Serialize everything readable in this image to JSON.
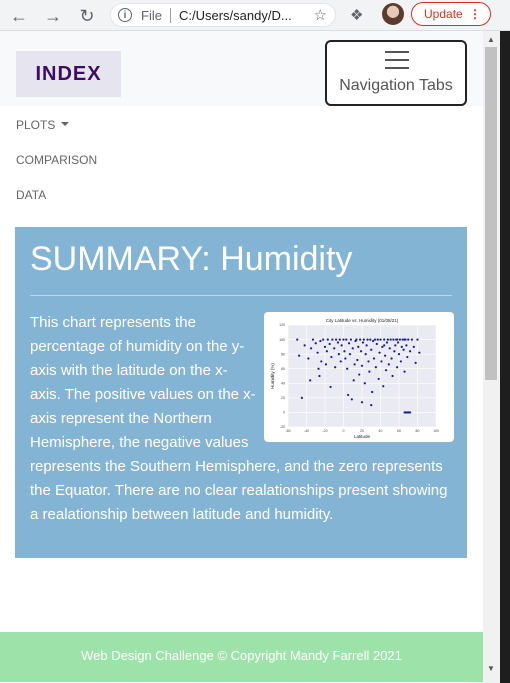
{
  "browser": {
    "scheme": "File",
    "url": "C:/Users/sandy/D...",
    "update_label": "Update"
  },
  "nav": {
    "brand": "INDEX",
    "toggle_label": "Navigation Tabs",
    "items": [
      "PLOTS",
      "COMPARISON",
      "DATA"
    ]
  },
  "summary": {
    "title": "SUMMARY: Humidity",
    "text": "This chart represents the percentage of humidity on the y-axis with the latitude on the x-axis. The positive values on the x-axis represent the Northern Hemisphere, the negative values represents the Southern Hemisphere, and the zero represents the Equator. There are no clear realationships present showing a realationship between latitude and humidity."
  },
  "chart_data": {
    "type": "scatter",
    "title": "City Latitude vs. Humidity (01/08/21)",
    "xlabel": "Latitude",
    "ylabel": "Humidity (%)",
    "xlim": [
      -60,
      100
    ],
    "ylim": [
      -20,
      120
    ],
    "xticks": [
      -60,
      -40,
      -20,
      0,
      20,
      40,
      60,
      80,
      100
    ],
    "yticks": [
      -20,
      0,
      20,
      40,
      60,
      80,
      100,
      120
    ],
    "grid": true,
    "point_color": "#1a1a8c",
    "points": [
      [
        -42,
        92
      ],
      [
        -38,
        74
      ],
      [
        -35,
        88
      ],
      [
        -33,
        100
      ],
      [
        -30,
        95
      ],
      [
        -28,
        82
      ],
      [
        -27,
        60
      ],
      [
        -25,
        98
      ],
      [
        -24,
        70
      ],
      [
        -22,
        100
      ],
      [
        -20,
        90
      ],
      [
        -19,
        66
      ],
      [
        -18,
        84
      ],
      [
        -17,
        100
      ],
      [
        -15,
        94
      ],
      [
        -13,
        76
      ],
      [
        -12,
        100
      ],
      [
        -10,
        88
      ],
      [
        -9,
        62
      ],
      [
        -8,
        100
      ],
      [
        -6,
        96
      ],
      [
        -5,
        80
      ],
      [
        -4,
        100
      ],
      [
        -3,
        70
      ],
      [
        -2,
        92
      ],
      [
        0,
        100
      ],
      [
        1,
        84
      ],
      [
        2,
        74
      ],
      [
        3,
        100
      ],
      [
        4,
        60
      ],
      [
        6,
        95
      ],
      [
        7,
        80
      ],
      [
        8,
        100
      ],
      [
        10,
        88
      ],
      [
        11,
        44
      ],
      [
        12,
        66
      ],
      [
        13,
        98
      ],
      [
        14,
        100
      ],
      [
        15,
        72
      ],
      [
        16,
        90
      ],
      [
        17,
        52
      ],
      [
        18,
        100
      ],
      [
        19,
        84
      ],
      [
        20,
        64
      ],
      [
        21,
        96
      ],
      [
        22,
        100
      ],
      [
        23,
        40
      ],
      [
        24,
        80
      ],
      [
        25,
        92
      ],
      [
        26,
        100
      ],
      [
        27,
        70
      ],
      [
        28,
        56
      ],
      [
        29,
        100
      ],
      [
        30,
        86
      ],
      [
        31,
        28
      ],
      [
        32,
        98
      ],
      [
        33,
        74
      ],
      [
        34,
        100
      ],
      [
        35,
        62
      ],
      [
        36,
        94
      ],
      [
        37,
        100
      ],
      [
        38,
        46
      ],
      [
        39,
        82
      ],
      [
        40,
        100
      ],
      [
        41,
        70
      ],
      [
        42,
        90
      ],
      [
        43,
        36
      ],
      [
        44,
        100
      ],
      [
        45,
        78
      ],
      [
        46,
        58
      ],
      [
        47,
        96
      ],
      [
        48,
        100
      ],
      [
        49,
        66
      ],
      [
        50,
        88
      ],
      [
        51,
        100
      ],
      [
        52,
        74
      ],
      [
        53,
        50
      ],
      [
        54,
        100
      ],
      [
        55,
        84
      ],
      [
        56,
        92
      ],
      [
        57,
        100
      ],
      [
        58,
        62
      ],
      [
        59,
        96
      ],
      [
        60,
        80
      ],
      [
        61,
        100
      ],
      [
        62,
        70
      ],
      [
        63,
        90
      ],
      [
        64,
        100
      ],
      [
        65,
        86
      ],
      [
        66,
        56
      ],
      [
        67,
        100
      ],
      [
        68,
        92
      ],
      [
        69,
        76
      ],
      [
        70,
        100
      ],
      [
        72,
        84
      ],
      [
        74,
        100
      ],
      [
        76,
        90
      ],
      [
        78,
        68
      ],
      [
        80,
        100
      ],
      [
        82,
        82
      ],
      [
        -45,
        20
      ],
      [
        -36,
        44
      ],
      [
        -14,
        35
      ],
      [
        5,
        24
      ],
      [
        9,
        18
      ],
      [
        -50,
        100
      ],
      [
        -48,
        78
      ],
      [
        66,
        100
      ],
      [
        58,
        100
      ],
      [
        44,
        92
      ],
      [
        66,
        0
      ],
      [
        67,
        0
      ],
      [
        68,
        0
      ],
      [
        69,
        0
      ],
      [
        70,
        0
      ],
      [
        71,
        0
      ],
      [
        72,
        0
      ],
      [
        30,
        10
      ],
      [
        20,
        14
      ],
      [
        -26,
        50
      ]
    ]
  },
  "footer": {
    "text": "Web Design Challenge © Copyright Mandy Farrell 2021"
  }
}
